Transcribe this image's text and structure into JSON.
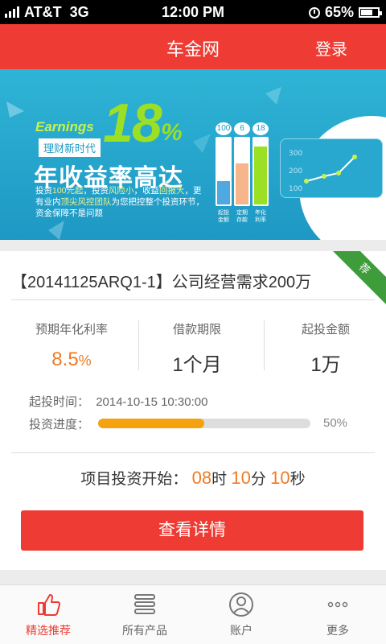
{
  "status_bar": {
    "carrier": "AT&T",
    "network": "3G",
    "time": "12:00 PM",
    "battery": "65%"
  },
  "header": {
    "title": "车金网",
    "login": "登录"
  },
  "banner": {
    "earnings": "Earnings",
    "rate": "18",
    "rate_unit": "%",
    "subtitle": "理财新时代",
    "headline": "年收益率高达",
    "desc_1": "投资",
    "desc_2": "100元起",
    "desc_3": "，投资",
    "desc_4": "风险小",
    "desc_5": "，收益",
    "desc_6": "回报大",
    "desc_7": "，更有业内",
    "desc_8": "顶尖风控团队",
    "desc_9": "为您把控整个投资环节，资金保障不是问题",
    "bars": [
      {
        "value": "100",
        "caption": "起投金额",
        "level": 0.35,
        "color": "#4fa8e0"
      },
      {
        "value": "6",
        "caption": "定期存款",
        "level": 0.62,
        "color": "#f6b58a"
      },
      {
        "value": "18",
        "caption": "年化利率",
        "level": 0.88,
        "color": "#9be024"
      }
    ],
    "mini_chart": {
      "ticks": [
        "300",
        "200",
        "100"
      ]
    },
    "dots": [
      true,
      false,
      false
    ]
  },
  "product": {
    "badge": "荐",
    "title": "【20141125ARQ1-1】公司经营需求200万",
    "stats": [
      {
        "label": "预期年化利率",
        "value": "8.5",
        "unit": "%"
      },
      {
        "label": "借款期限",
        "value": "1个月",
        "unit": ""
      },
      {
        "label": "起投金额",
        "value": "1万",
        "unit": ""
      }
    ],
    "start_label": "起投时间：",
    "start_time": "2014-10-15 10:30:00",
    "progress_label": "投资进度：",
    "progress_value": 0.5,
    "progress_text": "50%",
    "countdown_label": "项目投资开始：",
    "countdown_hours": "08",
    "countdown_h_unit": "时",
    "countdown_minutes": "10",
    "countdown_m_unit": "分",
    "countdown_seconds": "10",
    "countdown_s_unit": "秒",
    "button": "查看详情"
  },
  "tabs": [
    {
      "label": "精选推荐",
      "icon": "thumbs-up-icon",
      "active": true
    },
    {
      "label": "所有产品",
      "icon": "list-icon",
      "active": false
    },
    {
      "label": "账户",
      "icon": "user-icon",
      "active": false
    },
    {
      "label": "更多",
      "icon": "more-icon",
      "active": false
    }
  ],
  "colors": {
    "primary": "#ee3b33",
    "accent": "#f07a24",
    "progress": "#f5a20f",
    "banner": "#1e98c4",
    "badge": "#3f9c3a"
  }
}
